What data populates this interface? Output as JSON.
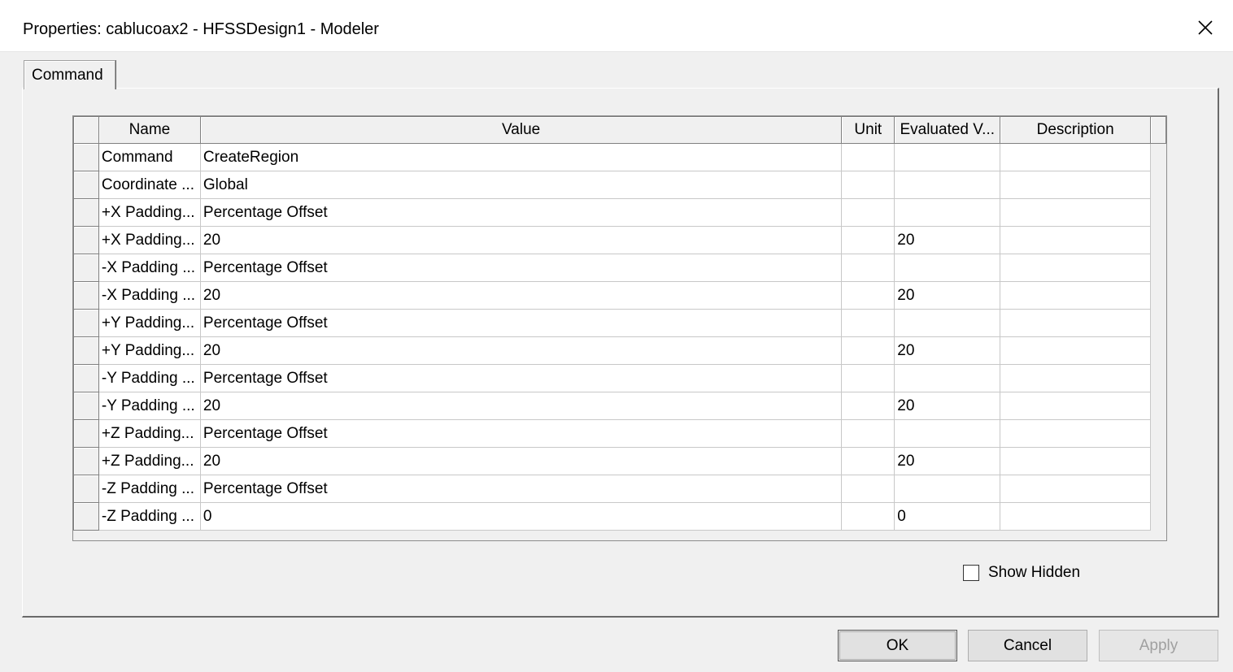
{
  "window": {
    "title": "Properties: cablucoax2 - HFSSDesign1 - Modeler",
    "close_icon": "close-icon"
  },
  "tabs": [
    {
      "label": "Command",
      "selected": true
    }
  ],
  "table": {
    "columns": [
      "Name",
      "Value",
      "Unit",
      "Evaluated V...",
      "Description"
    ],
    "rows": [
      {
        "name": "Command",
        "value": "CreateRegion",
        "unit": "",
        "evaluated": "",
        "description": ""
      },
      {
        "name": "Coordinate ...",
        "value": "Global",
        "unit": "",
        "evaluated": "",
        "description": ""
      },
      {
        "name": "+X Padding...",
        "value": "Percentage Offset",
        "unit": "",
        "evaluated": "",
        "description": ""
      },
      {
        "name": "+X Padding...",
        "value": "20",
        "unit": "",
        "evaluated": "20",
        "description": ""
      },
      {
        "name": "-X Padding ...",
        "value": "Percentage Offset",
        "unit": "",
        "evaluated": "",
        "description": ""
      },
      {
        "name": "-X Padding ...",
        "value": "20",
        "unit": "",
        "evaluated": "20",
        "description": ""
      },
      {
        "name": "+Y Padding...",
        "value": "Percentage Offset",
        "unit": "",
        "evaluated": "",
        "description": ""
      },
      {
        "name": "+Y Padding...",
        "value": "20",
        "unit": "",
        "evaluated": "20",
        "description": ""
      },
      {
        "name": "-Y Padding ...",
        "value": "Percentage Offset",
        "unit": "",
        "evaluated": "",
        "description": ""
      },
      {
        "name": "-Y Padding ...",
        "value": "20",
        "unit": "",
        "evaluated": "20",
        "description": ""
      },
      {
        "name": "+Z Padding...",
        "value": "Percentage Offset",
        "unit": "",
        "evaluated": "",
        "description": ""
      },
      {
        "name": "+Z Padding...",
        "value": "20",
        "unit": "",
        "evaluated": "20",
        "description": ""
      },
      {
        "name": "-Z Padding ...",
        "value": "Percentage Offset",
        "unit": "",
        "evaluated": "",
        "description": ""
      },
      {
        "name": "-Z Padding ...",
        "value": "0",
        "unit": "",
        "evaluated": "0",
        "description": ""
      }
    ]
  },
  "options": {
    "show_hidden_label": "Show Hidden",
    "show_hidden_checked": false
  },
  "buttons": {
    "ok": "OK",
    "cancel": "Cancel",
    "apply": "Apply",
    "apply_enabled": false
  }
}
